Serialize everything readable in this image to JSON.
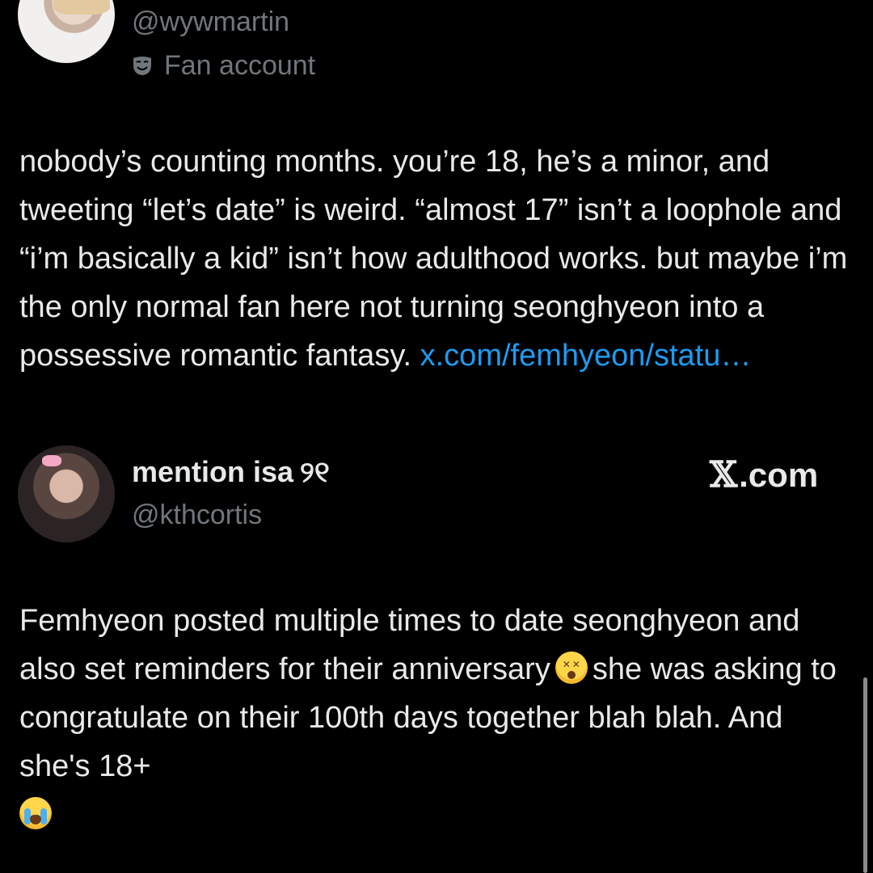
{
  "tweet_1": {
    "handle": "@wywmartin",
    "badge": "Fan account",
    "text": "nobody’s counting months. you’re 18, he’s a minor, and tweeting “let’s date” is weird. “almost 17” isn’t a loophole and “i’m basically a kid” isn’t how adulthood works. but maybe i’m the only normal fan here not turning seonghyeon into a possessive romantic fantasy.",
    "link": "x.com/femhyeon/statu…"
  },
  "tweet_2": {
    "display_name": "mention isa",
    "name_suffix": "୨୧",
    "handle": "@kthcortis",
    "source": ".com",
    "text_part1": "Femhyeon posted multiple times to date seonghyeon and also set reminders for their anniversary",
    "text_part2": "she was asking to congratulate on their 100th days together blah blah. And she's 18+"
  },
  "icons": {
    "badge_icon": "theater-mask-icon",
    "emoji_1": "dizzy-face-emoji",
    "emoji_2": "loudly-crying-emoji"
  },
  "colors": {
    "background": "#000000",
    "text": "#e7e9ea",
    "secondary": "#71767b",
    "link": "#1d9bf0"
  }
}
